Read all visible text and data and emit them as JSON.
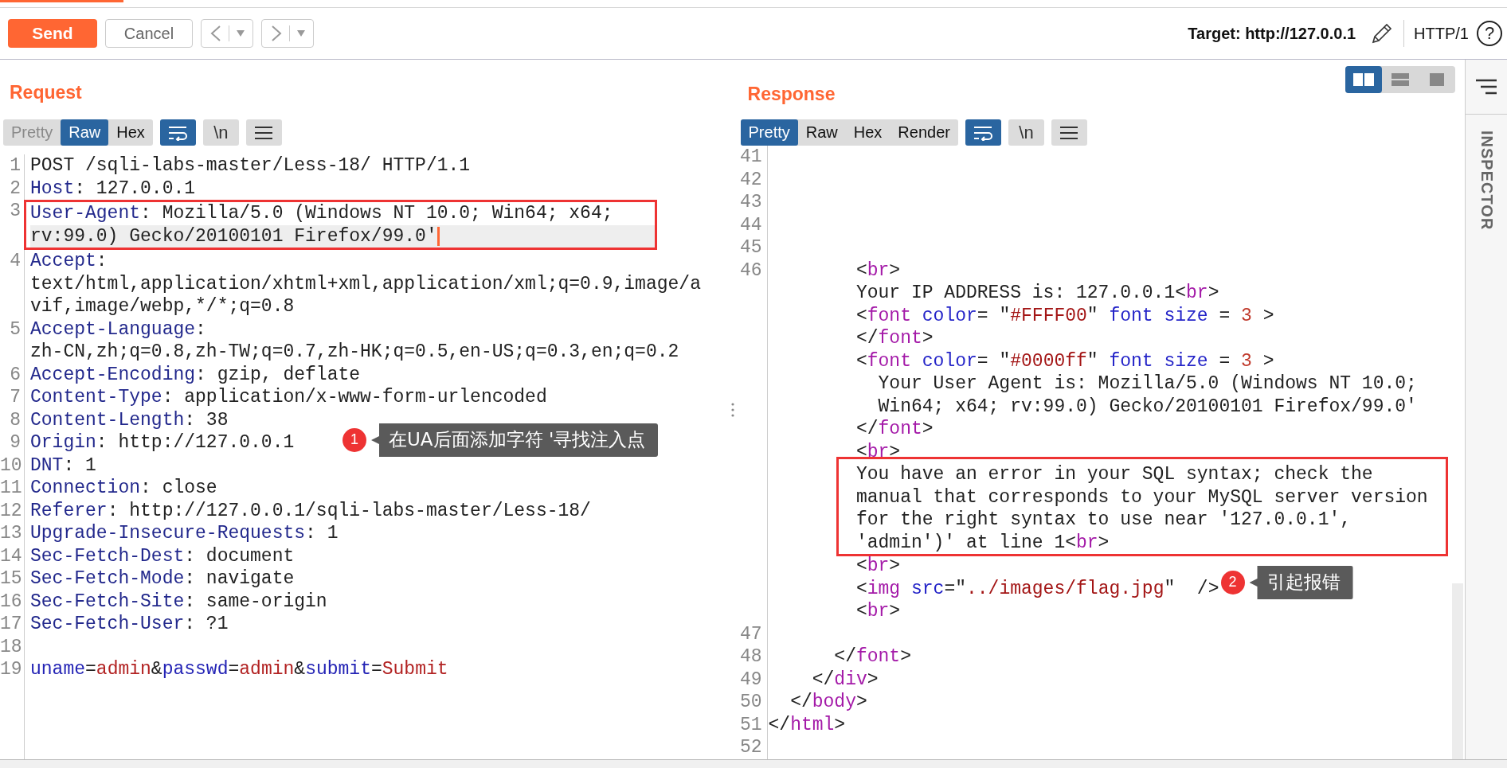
{
  "toolbar": {
    "send": "Send",
    "cancel": "Cancel",
    "target": "Target: http://127.0.0.1",
    "protocol": "HTTP/1",
    "help": "?"
  },
  "panes": [
    {
      "kind": "request",
      "title": "Request",
      "tabs": [
        {
          "label": "Pretty",
          "selected": false,
          "disabled": true
        },
        {
          "label": "Raw",
          "selected": true,
          "disabled": false
        },
        {
          "label": "Hex",
          "selected": false,
          "disabled": false
        }
      ],
      "wrap_on": true,
      "newline_label": "\\n",
      "rows": [
        {
          "kind": "row",
          "n": "1",
          "tokens": [
            {
              "kind": "plain",
              "text": "POST /sqli-labs-master/Less-18/ HTTP/1.1"
            }
          ]
        },
        {
          "kind": "row",
          "n": "2",
          "tokens": [
            {
              "kind": "name",
              "text": "Host"
            },
            {
              "kind": "plain",
              "text": ": 127.0.0.1"
            }
          ]
        },
        {
          "kind": "box",
          "rows": [
            {
              "n": "3",
              "tokens": [
                {
                  "kind": "name",
                  "text": "User-Agent"
                },
                {
                  "kind": "plain",
                  "text": ": Mozilla/5.0 (Windows NT 10.0; Win64; x64;"
                }
              ]
            },
            {
              "current": true,
              "tokens": [
                {
                  "kind": "plain",
                  "text": "rv:99.0) Gecko/20100101 Firefox/99.0'"
                }
              ]
            }
          ]
        },
        {
          "kind": "row",
          "n": "4",
          "tokens": [
            {
              "kind": "name",
              "text": "Accept"
            },
            {
              "kind": "plain",
              "text": ":"
            }
          ]
        },
        {
          "kind": "row",
          "tokens": [
            {
              "kind": "plain",
              "text": "text/html,application/xhtml+xml,application/xml;q=0.9,image/a"
            }
          ]
        },
        {
          "kind": "row",
          "tokens": [
            {
              "kind": "plain",
              "text": "vif,image/webp,*/*;q=0.8"
            }
          ]
        },
        {
          "kind": "row",
          "n": "5",
          "tokens": [
            {
              "kind": "name",
              "text": "Accept-Language"
            },
            {
              "kind": "plain",
              "text": ":"
            }
          ]
        },
        {
          "kind": "row",
          "tokens": [
            {
              "kind": "plain",
              "text": "zh-CN,zh;q=0.8,zh-TW;q=0.7,zh-HK;q=0.5,en-US;q=0.3,en;q=0.2"
            }
          ]
        },
        {
          "kind": "row",
          "n": "6",
          "tokens": [
            {
              "kind": "name",
              "text": "Accept-Encoding"
            },
            {
              "kind": "plain",
              "text": ": gzip, deflate"
            }
          ]
        },
        {
          "kind": "row",
          "n": "7",
          "tokens": [
            {
              "kind": "name",
              "text": "Content-Type"
            },
            {
              "kind": "plain",
              "text": ": application/x-www-form-urlencoded"
            }
          ]
        },
        {
          "kind": "row",
          "n": "8",
          "tokens": [
            {
              "kind": "name",
              "text": "Content-Length"
            },
            {
              "kind": "plain",
              "text": ": 38"
            }
          ]
        },
        {
          "kind": "row",
          "n": "9",
          "tokens": [
            {
              "kind": "name",
              "text": "Origin"
            },
            {
              "kind": "plain",
              "text": ": http://127.0.0.1"
            }
          ]
        },
        {
          "kind": "row",
          "n": "10",
          "tokens": [
            {
              "kind": "name",
              "text": "DNT"
            },
            {
              "kind": "plain",
              "text": ": 1"
            }
          ]
        },
        {
          "kind": "row",
          "n": "11",
          "tokens": [
            {
              "kind": "name",
              "text": "Connection"
            },
            {
              "kind": "plain",
              "text": ": close"
            }
          ]
        },
        {
          "kind": "row",
          "n": "12",
          "tokens": [
            {
              "kind": "name",
              "text": "Referer"
            },
            {
              "kind": "plain",
              "text": ": http://127.0.0.1/sqli-labs-master/Less-18/"
            }
          ]
        },
        {
          "kind": "row",
          "n": "13",
          "tokens": [
            {
              "kind": "name",
              "text": "Upgrade-Insecure-Requests"
            },
            {
              "kind": "plain",
              "text": ": 1"
            }
          ]
        },
        {
          "kind": "row",
          "n": "14",
          "tokens": [
            {
              "kind": "name",
              "text": "Sec-Fetch-Dest"
            },
            {
              "kind": "plain",
              "text": ": document"
            }
          ]
        },
        {
          "kind": "row",
          "n": "15",
          "tokens": [
            {
              "kind": "name",
              "text": "Sec-Fetch-Mode"
            },
            {
              "kind": "plain",
              "text": ": navigate"
            }
          ]
        },
        {
          "kind": "row",
          "n": "16",
          "tokens": [
            {
              "kind": "name",
              "text": "Sec-Fetch-Site"
            },
            {
              "kind": "plain",
              "text": ": same-origin"
            }
          ]
        },
        {
          "kind": "row",
          "n": "17",
          "tokens": [
            {
              "kind": "name",
              "text": "Sec-Fetch-User"
            },
            {
              "kind": "plain",
              "text": ": ?1"
            }
          ]
        },
        {
          "kind": "row",
          "n": "18"
        },
        {
          "kind": "row",
          "n": "19",
          "tokens": [
            {
              "kind": "param",
              "text": "uname"
            },
            {
              "kind": "plain",
              "text": "="
            },
            {
              "kind": "value",
              "text": "admin"
            },
            {
              "kind": "plain",
              "text": "&"
            },
            {
              "kind": "param",
              "text": "passwd"
            },
            {
              "kind": "plain",
              "text": "="
            },
            {
              "kind": "value",
              "text": "admin"
            },
            {
              "kind": "plain",
              "text": "&"
            },
            {
              "kind": "param",
              "text": "submit"
            },
            {
              "kind": "plain",
              "text": "="
            },
            {
              "kind": "value",
              "text": "Submit"
            }
          ]
        }
      ],
      "callout": {
        "number": "1",
        "text": "在UA后面添加字符 '寻找注入点"
      }
    },
    {
      "kind": "response",
      "title": "Response",
      "layouts": [
        {
          "kind": "side",
          "selected": true
        },
        {
          "kind": "stack",
          "selected": false
        },
        {
          "kind": "single",
          "selected": false
        }
      ],
      "tabs": [
        {
          "label": "Pretty",
          "selected": true,
          "disabled": false
        },
        {
          "label": "Raw",
          "selected": false,
          "disabled": false
        },
        {
          "label": "Hex",
          "selected": false,
          "disabled": false
        },
        {
          "label": "Render",
          "selected": false,
          "disabled": false
        }
      ],
      "wrap_on": true,
      "newline_label": "\\n",
      "rows": [
        {
          "kind": "row",
          "n": "41"
        },
        {
          "kind": "row",
          "n": "42"
        },
        {
          "kind": "row",
          "n": "43"
        },
        {
          "kind": "row",
          "n": "44"
        },
        {
          "kind": "row",
          "n": "45"
        },
        {
          "kind": "row",
          "n": "46",
          "indent": "        ",
          "tokens": [
            {
              "kind": "plain",
              "text": "<"
            },
            {
              "kind": "tag",
              "text": "br"
            },
            {
              "kind": "plain",
              "text": ">"
            }
          ]
        },
        {
          "kind": "row",
          "indent": "        ",
          "tokens": [
            {
              "kind": "plain",
              "text": "Your IP ADDRESS is: 127.0.0.1<"
            },
            {
              "kind": "tag",
              "text": "br"
            },
            {
              "kind": "plain",
              "text": ">"
            }
          ]
        },
        {
          "kind": "row",
          "indent": "        ",
          "tokens": [
            {
              "kind": "plain",
              "text": "<"
            },
            {
              "kind": "tag",
              "text": "font"
            },
            {
              "kind": "attr",
              "text": " color"
            },
            {
              "kind": "plain",
              "text": "= \""
            },
            {
              "kind": "str",
              "text": "#FFFF00"
            },
            {
              "kind": "plain",
              "text": "\" "
            },
            {
              "kind": "attr",
              "text": "font size"
            },
            {
              "kind": "plain",
              "text": " = "
            },
            {
              "kind": "num",
              "text": "3"
            },
            {
              "kind": "plain",
              "text": " >"
            }
          ]
        },
        {
          "kind": "row",
          "indent": "        ",
          "tokens": [
            {
              "kind": "plain",
              "text": "</"
            },
            {
              "kind": "tag",
              "text": "font"
            },
            {
              "kind": "plain",
              "text": ">"
            }
          ]
        },
        {
          "kind": "row",
          "indent": "        ",
          "tokens": [
            {
              "kind": "plain",
              "text": "<"
            },
            {
              "kind": "tag",
              "text": "font"
            },
            {
              "kind": "attr",
              "text": " color"
            },
            {
              "kind": "plain",
              "text": "= \""
            },
            {
              "kind": "str",
              "text": "#0000ff"
            },
            {
              "kind": "plain",
              "text": "\" "
            },
            {
              "kind": "attr",
              "text": "font size"
            },
            {
              "kind": "plain",
              "text": " = "
            },
            {
              "kind": "num",
              "text": "3"
            },
            {
              "kind": "plain",
              "text": " >"
            }
          ]
        },
        {
          "kind": "row",
          "indent": "          ",
          "tokens": [
            {
              "kind": "plain",
              "text": "Your User Agent is: Mozilla/5.0 (Windows NT 10.0;"
            }
          ]
        },
        {
          "kind": "row",
          "indent": "          ",
          "tokens": [
            {
              "kind": "plain",
              "text": "Win64; x64; rv:99.0) Gecko/20100101 Firefox/99.0'"
            }
          ]
        },
        {
          "kind": "row",
          "indent": "        ",
          "tokens": [
            {
              "kind": "plain",
              "text": "</"
            },
            {
              "kind": "tag",
              "text": "font"
            },
            {
              "kind": "plain",
              "text": ">"
            }
          ]
        },
        {
          "kind": "row",
          "indent": "        ",
          "tokens": [
            {
              "kind": "plain",
              "text": "<"
            },
            {
              "kind": "tag",
              "text": "br"
            },
            {
              "kind": "plain",
              "text": ">"
            }
          ]
        },
        {
          "kind": "box",
          "rows": [
            {
              "indent": "        ",
              "tokens": [
                {
                  "kind": "plain",
                  "text": "You have an error in your SQL syntax; check the"
                }
              ]
            },
            {
              "indent": "        ",
              "tokens": [
                {
                  "kind": "plain",
                  "text": "manual that corresponds to your MySQL server version"
                }
              ]
            },
            {
              "indent": "        ",
              "tokens": [
                {
                  "kind": "plain",
                  "text": "for the right syntax to use near '127.0.0.1',"
                }
              ]
            },
            {
              "indent": "        ",
              "tokens": [
                {
                  "kind": "plain",
                  "text": "'admin')' at line 1<"
                },
                {
                  "kind": "tag",
                  "text": "br"
                },
                {
                  "kind": "plain",
                  "text": ">"
                }
              ]
            }
          ]
        },
        {
          "kind": "row",
          "indent": "        ",
          "tokens": [
            {
              "kind": "plain",
              "text": "<"
            },
            {
              "kind": "tag",
              "text": "br"
            },
            {
              "kind": "plain",
              "text": ">"
            }
          ]
        },
        {
          "kind": "row",
          "indent": "        ",
          "tokens": [
            {
              "kind": "plain",
              "text": "<"
            },
            {
              "kind": "tag",
              "text": "img"
            },
            {
              "kind": "attr",
              "text": " src"
            },
            {
              "kind": "plain",
              "text": "=\""
            },
            {
              "kind": "str",
              "text": "../images/flag.jpg"
            },
            {
              "kind": "plain",
              "text": "\"  />"
            }
          ]
        },
        {
          "kind": "row",
          "indent": "        ",
          "tokens": [
            {
              "kind": "plain",
              "text": "<"
            },
            {
              "kind": "tag",
              "text": "br"
            },
            {
              "kind": "plain",
              "text": ">"
            }
          ]
        },
        {
          "kind": "row",
          "n": "47"
        },
        {
          "kind": "row",
          "n": "48",
          "indent": "      ",
          "tokens": [
            {
              "kind": "plain",
              "text": "</"
            },
            {
              "kind": "tag",
              "text": "font"
            },
            {
              "kind": "plain",
              "text": ">"
            }
          ]
        },
        {
          "kind": "row",
          "n": "49",
          "indent": "    ",
          "tokens": [
            {
              "kind": "plain",
              "text": "</"
            },
            {
              "kind": "tag",
              "text": "div"
            },
            {
              "kind": "plain",
              "text": ">"
            }
          ]
        },
        {
          "kind": "row",
          "n": "50",
          "indent": "  ",
          "tokens": [
            {
              "kind": "plain",
              "text": "</"
            },
            {
              "kind": "tag",
              "text": "body"
            },
            {
              "kind": "plain",
              "text": ">"
            }
          ]
        },
        {
          "kind": "row",
          "n": "51",
          "tokens": [
            {
              "kind": "plain",
              "text": "</"
            },
            {
              "kind": "tag",
              "text": "html"
            },
            {
              "kind": "plain",
              "text": ">"
            }
          ]
        },
        {
          "kind": "row",
          "n": "52"
        }
      ],
      "callout": {
        "number": "2",
        "text": "引起报错"
      }
    }
  ],
  "inspector": {
    "label": "INSPECTOR"
  }
}
